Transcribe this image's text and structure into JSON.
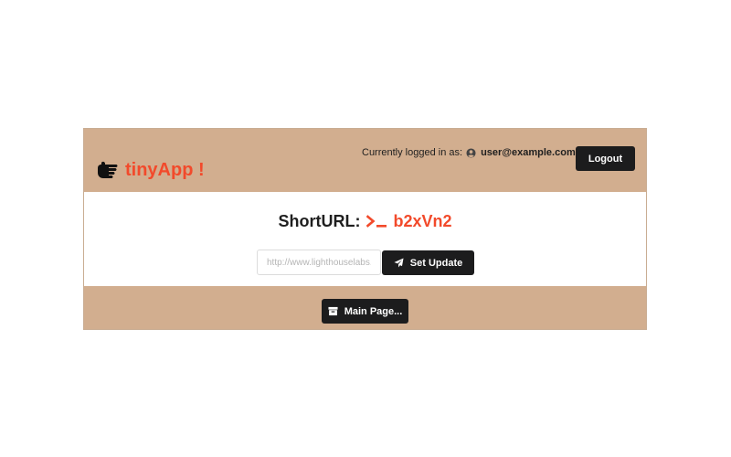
{
  "brand": {
    "name": "tinyApp !",
    "color": "#f24a2b",
    "icon": "pointing-hand-icon"
  },
  "navbar": {
    "login_prefix": "Currently logged in as:",
    "user_icon": "user-circle-icon",
    "user_email": "user@example.com",
    "logout_label": "Logout"
  },
  "main": {
    "title_prefix": "ShortURL:",
    "prompt_icon": "terminal-icon",
    "short_code": "b2xVn2",
    "accent_color": "#f24a2b",
    "url_input": {
      "value": "",
      "placeholder": "http://www.lighthouselabs.ca"
    },
    "update_button": {
      "label": "Set Update",
      "icon": "paper-plane-icon"
    }
  },
  "footer": {
    "main_page_button": {
      "label": "Main Page...",
      "icon": "archive-box-icon"
    }
  },
  "colors": {
    "header_bg": "#d2ae8f",
    "button_bg": "#1c1c1d"
  }
}
